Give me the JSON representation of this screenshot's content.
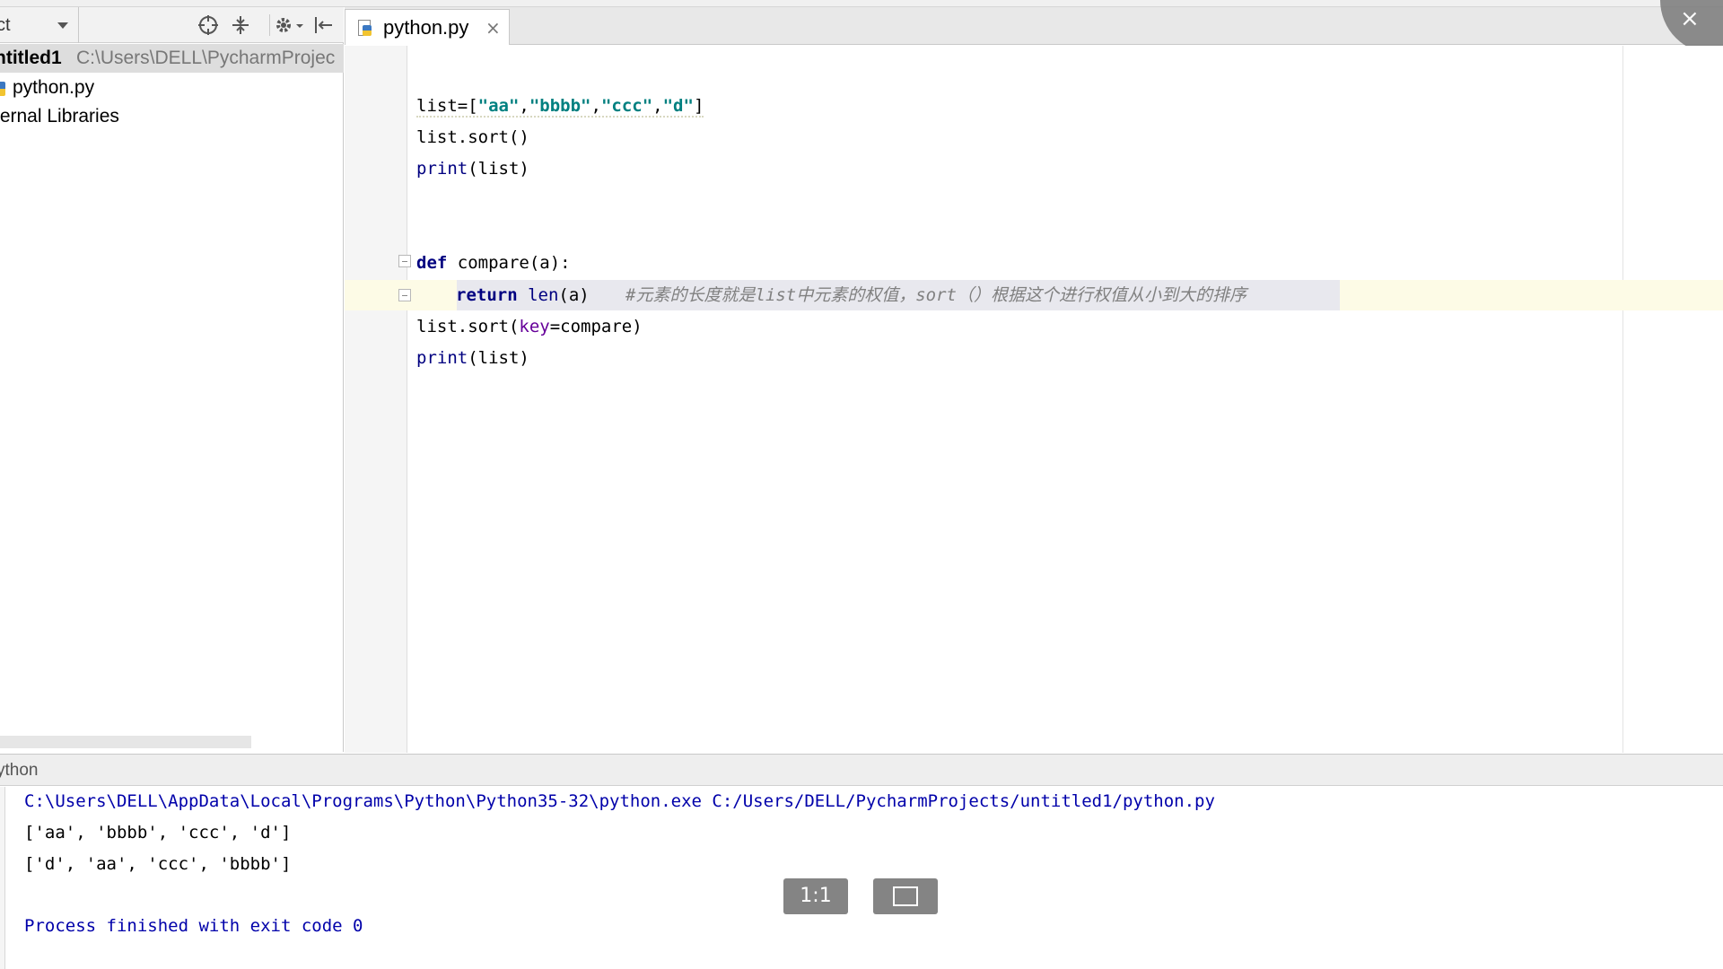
{
  "project_panel": {
    "dropdown_label": "ct",
    "icons": [
      "crosshair-icon",
      "collapse-icon",
      "gear-icon",
      "hide-icon"
    ],
    "tree": {
      "project_name": "ntitled1",
      "project_path": "C:\\Users\\DELL\\PycharmProjec",
      "file": "python.py",
      "external": "ternal Libraries"
    }
  },
  "editor": {
    "tab_label": "python.py",
    "tab_close": "×",
    "window_close": "×",
    "code": {
      "l1_a": "list=[",
      "l1_s1": "\"aa\"",
      "l1_c1": ",",
      "l1_s2": "\"bbbb\"",
      "l1_c2": ",",
      "l1_s3": "\"ccc\"",
      "l1_c3": ",",
      "l1_s4": "\"d\"",
      "l1_b": "]",
      "l2": "list.sort()",
      "l3_fn": "print",
      "l3_rest": "(list)",
      "l4_kw": "def",
      "l4_rest": " compare(a):",
      "l5_kw": "return",
      "l5_fn": " len",
      "l5_rest": "(a)",
      "l5_comment": "#元素的长度就是list中元素的权值，sort（）根据这个进行权值从小到大的排序",
      "l6_a": "list.sort(",
      "l6_param": "key",
      "l6_b": "=compare)",
      "l7_fn": "print",
      "l7_rest": "(list)"
    }
  },
  "run_panel": {
    "title": "ython",
    "command": "C:\\Users\\DELL\\AppData\\Local\\Programs\\Python\\Python35-32\\python.exe C:/Users/DELL/PycharmProjects/untitled1/python.py",
    "output_1": "['aa', 'bbbb', 'ccc', 'd']",
    "output_2": "['d', 'aa', 'ccc', 'bbbb']",
    "exit_msg": "Process finished with exit code 0"
  },
  "viewer": {
    "actual_size_label": "1:1"
  }
}
